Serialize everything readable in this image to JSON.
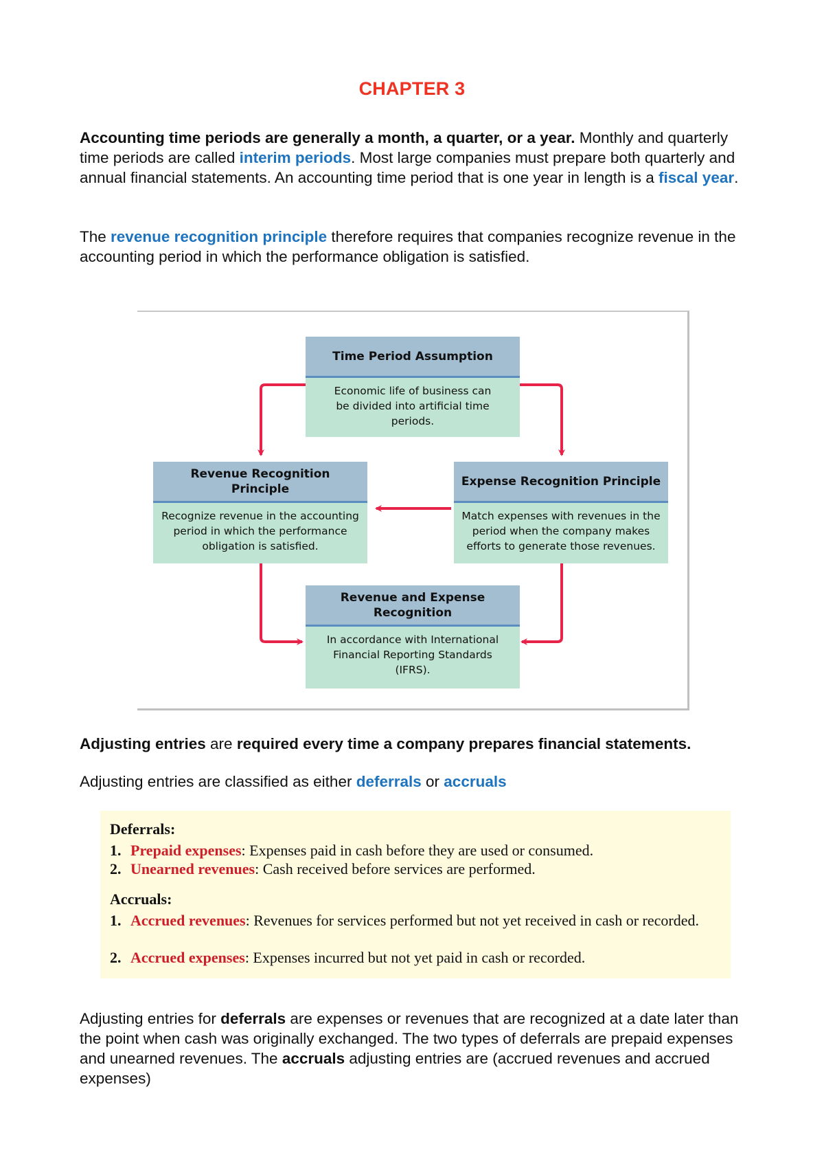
{
  "title": "CHAPTER 3",
  "para1": {
    "bold": "Accounting time periods are generally a month, a quarter, or a year.",
    "t1": " Monthly and quarterly time periods are called ",
    "term1": "interim periods",
    "t2": ". Most large companies must prepare both quarterly and annual financial statements. An accounting time period that is one year in length is a ",
    "term2": "fiscal year",
    "t3": "."
  },
  "para2": {
    "t1": "The ",
    "term": "revenue recognition principle",
    "t2": " therefore requires that companies recognize revenue in the accounting period in which the performance obligation is satisfied."
  },
  "diagram": {
    "colors": {
      "header": "#a3bdd1",
      "body": "#c0e4d4",
      "arrow": "#e8234a",
      "divider": "#5b8dc0"
    },
    "top": {
      "title": "Time Period Assumption",
      "body": "Economic life of business can be divided into artificial time periods."
    },
    "left": {
      "title": "Revenue Recognition Principle",
      "body": "Recognize revenue in the accounting period in which the performance obligation is satisfied."
    },
    "right": {
      "title": "Expense Recognition Principle",
      "body": "Match expenses with revenues in the period when the company makes efforts to generate those revenues."
    },
    "bottom": {
      "title": "Revenue and Expense Recognition",
      "body": "In accordance with International Financial Reporting Standards (IFRS)."
    }
  },
  "para3": {
    "b1": "Adjusting entries",
    "t1": " are ",
    "b2": "required every time a company prepares financial statements."
  },
  "para4": {
    "t1": "Adjusting entries are classified as either ",
    "term1": "deferrals",
    "t2": " or ",
    "term2": "accruals"
  },
  "classification": {
    "deferrals_heading": "Deferrals:",
    "deferrals": [
      {
        "num": "1.",
        "term": "Prepaid expenses",
        "desc": ": Expenses paid in cash before they are used or consumed."
      },
      {
        "num": "2.",
        "term": "Unearned revenues",
        "desc": ": Cash received before services are performed."
      }
    ],
    "accruals_heading": "Accruals:",
    "accruals": [
      {
        "num": "1.",
        "term": "Accrued revenues",
        "desc": ": Revenues for services performed but not yet received in cash or recorded."
      },
      {
        "num": "2.",
        "term": "Accrued expenses",
        "desc": ": Expenses incurred but not yet paid in cash or recorded."
      }
    ]
  },
  "para5": {
    "t1": "Adjusting entries for ",
    "b1": "deferrals",
    "t2": " are expenses or revenues that are recognized at a date later than the point when cash was originally exchanged. The two types of deferrals are prepaid expenses and unearned revenues. The ",
    "b2": "accruals",
    "t3": " adjusting entries are (accrued revenues and accrued expenses)"
  }
}
